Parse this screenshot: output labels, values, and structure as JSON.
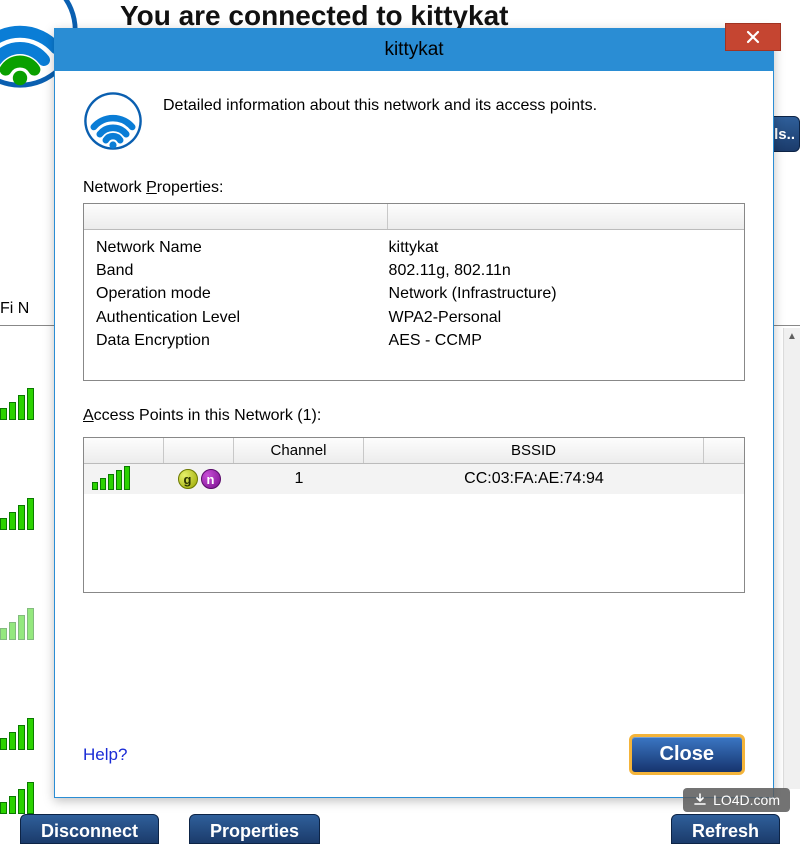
{
  "background": {
    "headline": "You are connected to kittykat",
    "side_label": "Fi N",
    "right_tab": "ls..",
    "buttons": {
      "disconnect": "Disconnect",
      "properties": "Properties",
      "refresh": "Refresh"
    }
  },
  "dialog": {
    "title": "kittykat",
    "description": "Detailed information about this network and its access points.",
    "properties_label_prefix": "Network ",
    "properties_label_ul": "P",
    "properties_label_suffix": "roperties:",
    "properties": [
      {
        "k": "Network Name",
        "v": "kittykat"
      },
      {
        "k": "Band",
        "v": "802.11g, 802.11n"
      },
      {
        "k": "Operation mode",
        "v": "Network (Infrastructure)"
      },
      {
        "k": "Authentication Level",
        "v": "WPA2-Personal"
      },
      {
        "k": "Data Encryption",
        "v": "AES - CCMP"
      }
    ],
    "ap_label_ul": "A",
    "ap_label_rest": "ccess Points in this Network (1):",
    "ap_headers": {
      "channel": "Channel",
      "bssid": "BSSID"
    },
    "ap_rows": [
      {
        "badge1": "g",
        "badge2": "n",
        "channel": "1",
        "bssid": "CC:03:FA:AE:74:94"
      }
    ],
    "help": "Help?",
    "close": "Close"
  },
  "watermark": "LO4D.com"
}
